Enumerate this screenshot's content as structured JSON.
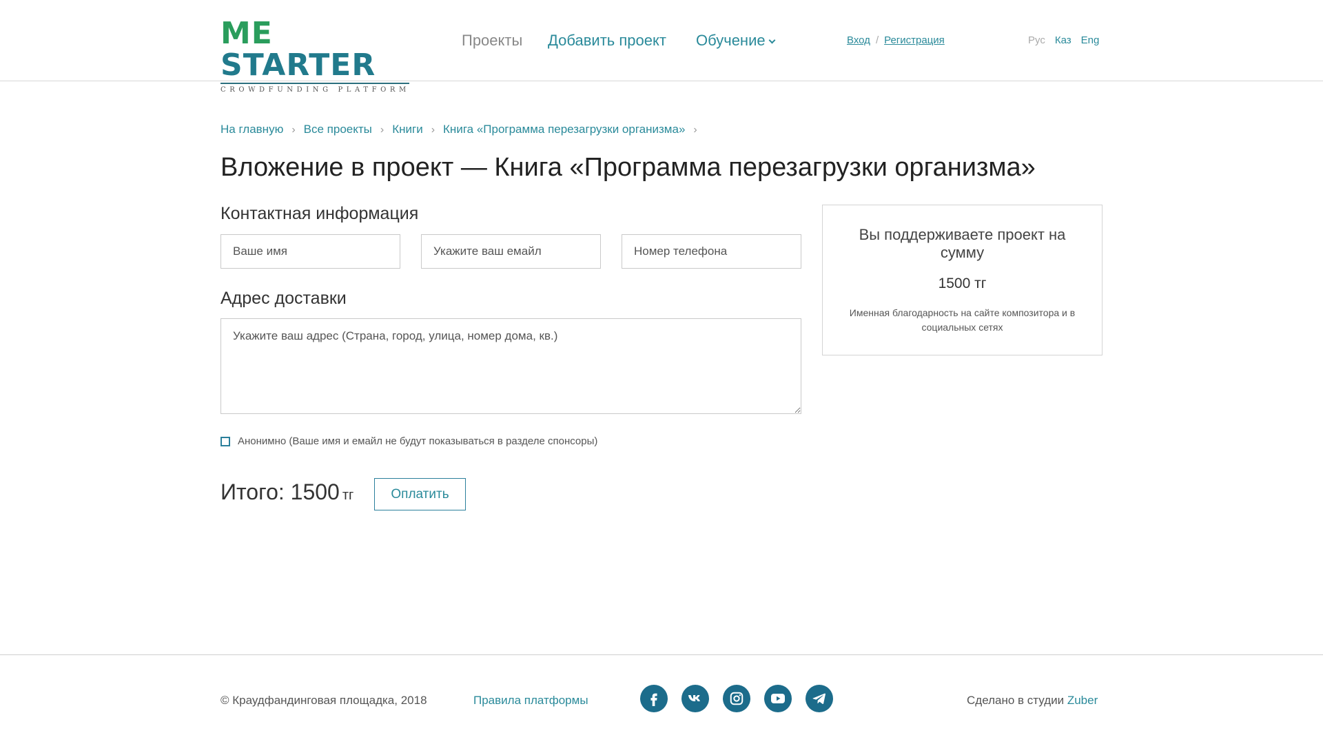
{
  "header": {
    "logo_me": "ME",
    "logo_starter": "STARTER",
    "logo_sub": "CROWDFUNDING PLATFORM",
    "nav": {
      "projects": "Проекты",
      "add_project": "Добавить проект",
      "learning": "Обучение"
    },
    "auth": {
      "login": "Вход",
      "separator": "/",
      "register": "Регистрация"
    },
    "langs": {
      "ru": "Рус",
      "kz": "Каз",
      "en": "Eng"
    }
  },
  "breadcrumb": {
    "home": "На главную",
    "all_projects": "Все проекты",
    "books": "Книги",
    "current": "Книга «Программа перезагрузки организма»"
  },
  "page_title": "Вложение в проект — Книга «Программа перезагрузки организма»",
  "contact": {
    "title": "Контактная информация",
    "name_placeholder": "Ваше имя",
    "email_placeholder": "Укажите ваш емайл",
    "phone_placeholder": "Номер телефона"
  },
  "delivery": {
    "title": "Адрес доставки",
    "address_placeholder": "Укажите ваш адрес (Страна, город, улица, номер дома, кв.)"
  },
  "anonymous_label": "Анонимно (Ваше имя и емайл не будут показываться в разделе спонсоры)",
  "total": {
    "label": "Итого: 1500",
    "currency": "тг",
    "pay_button": "Оплатить"
  },
  "summary": {
    "title": "Вы поддерживаете проект на сумму",
    "amount": "1500 тг",
    "reward": "Именная благодарность на сайте композитора и в социальных сетях"
  },
  "footer": {
    "copyright": "© Краудфандинговая площадка, 2018",
    "rules": "Правила платформы",
    "made_in": "Сделано в студии",
    "studio": "Zuber",
    "socials": [
      "facebook-icon",
      "vk-icon",
      "instagram-icon",
      "youtube-icon",
      "telegram-icon"
    ]
  },
  "colors": {
    "accent": "#2a8a9a",
    "social_bg": "#1c6c8b",
    "logo_green": "#2a9d5c"
  }
}
